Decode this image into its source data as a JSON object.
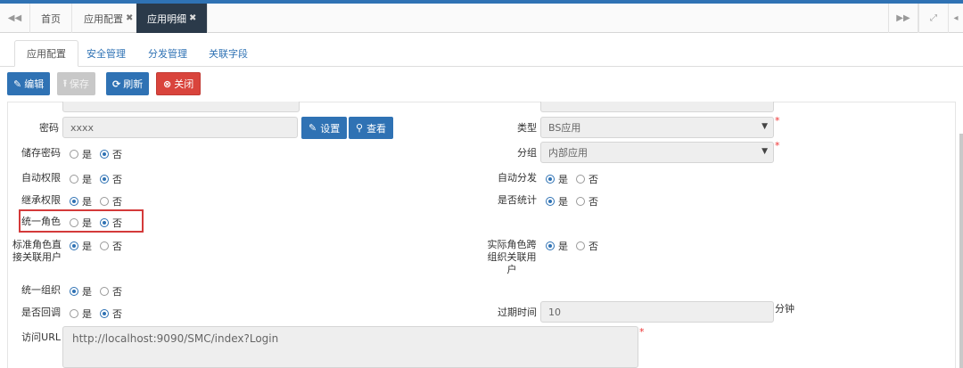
{
  "tabbar": {
    "prev_icon": "double-left-icon",
    "tabs": [
      {
        "label": "首页"
      },
      {
        "label": "应用配置",
        "close": "✖"
      },
      {
        "label": "应用明细",
        "close": "✖"
      }
    ],
    "next_icon": "double-right-icon",
    "fullscreen_icon": "expand-icon"
  },
  "subtabs": [
    "应用配置",
    "安全管理",
    "分发管理",
    "关联字段"
  ],
  "toolbar": {
    "edit": "编辑",
    "save": "保存",
    "refresh": "刷新",
    "close": "关闭"
  },
  "form": {
    "password": {
      "label": "密码",
      "value": "xxxx",
      "set_btn": "设置",
      "view_btn": "查看"
    },
    "type": {
      "label": "类型",
      "value": "BS应用",
      "required": "*"
    },
    "store_password": {
      "label": "储存密码",
      "yes": "是",
      "no": "否",
      "selected": "否"
    },
    "group": {
      "label": "分组",
      "value": "内部应用",
      "required": "*"
    },
    "auto_perm": {
      "label": "自动权限",
      "yes": "是",
      "no": "否",
      "selected": "否"
    },
    "auto_dist": {
      "label": "自动分发",
      "yes": "是",
      "no": "否",
      "selected": "是"
    },
    "inherit_perm": {
      "label": "继承权限",
      "yes": "是",
      "no": "否",
      "selected": "是"
    },
    "stats": {
      "label": "是否统计",
      "yes": "是",
      "no": "否",
      "selected": "是"
    },
    "unified_role": {
      "label": "统一角色",
      "yes": "是",
      "no": "否",
      "selected": "否"
    },
    "std_role_line1": "标准角色直",
    "std_role_line2": "接关联用户",
    "std_role": {
      "yes": "是",
      "no": "否",
      "selected": "是"
    },
    "actual_role_line1": "实际角色跨",
    "actual_role_line2": "组织关联用",
    "actual_role_line3": "户",
    "actual_role": {
      "yes": "是",
      "no": "否",
      "selected": "是"
    },
    "unified_org": {
      "label": "统一组织",
      "yes": "是",
      "no": "否",
      "selected": "是"
    },
    "callback": {
      "label": "是否回调",
      "yes": "是",
      "no": "否",
      "selected": "否"
    },
    "expire": {
      "label": "过期时间",
      "value": "10",
      "unit": "分钟"
    },
    "url": {
      "label": "访问URL",
      "value": "http://localhost:9090/SMC/index?Login",
      "required": "*"
    }
  },
  "colors": {
    "primary": "#2f72b4",
    "danger": "#d9443c",
    "highlight": "#d43a3a",
    "dark_tab": "#2b3a4a"
  }
}
